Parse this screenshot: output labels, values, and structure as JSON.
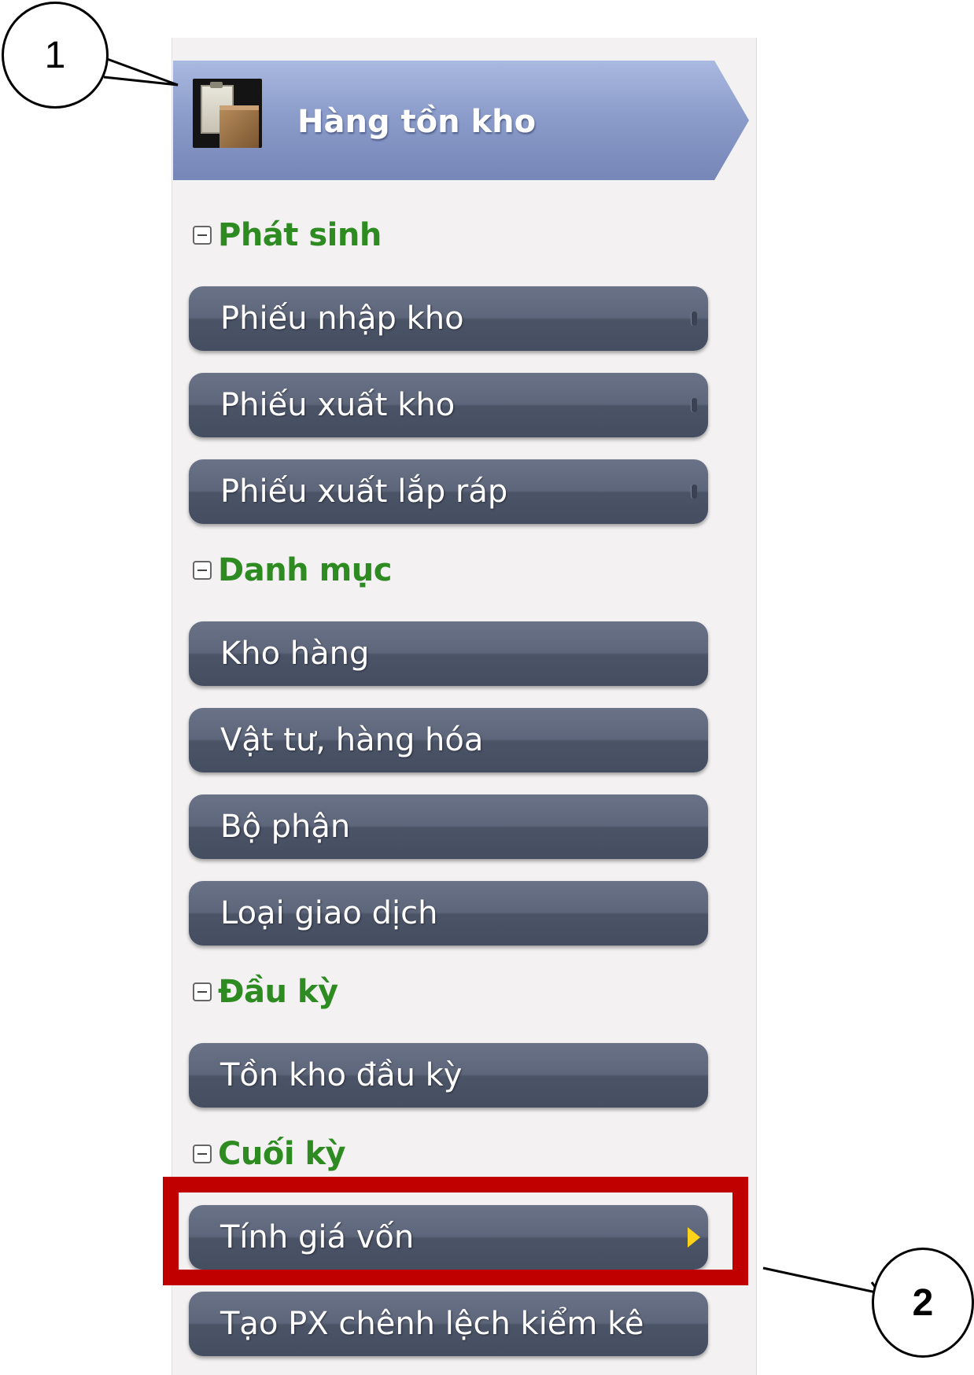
{
  "header": {
    "title": "Hàng tồn kho",
    "icon": "inventory-clipboard-box-icon"
  },
  "sections": [
    {
      "label": "Phát sinh",
      "items": [
        {
          "label": "Phiếu nhập kho"
        },
        {
          "label": "Phiếu xuất kho"
        },
        {
          "label": "Phiếu xuất lắp ráp"
        }
      ]
    },
    {
      "label": "Danh mục",
      "items": [
        {
          "label": "Kho hàng"
        },
        {
          "label": "Vật tư, hàng hóa"
        },
        {
          "label": "Bộ phận"
        },
        {
          "label": "Loại giao dịch"
        }
      ]
    },
    {
      "label": "Đầu kỳ",
      "items": [
        {
          "label": "Tồn kho đầu kỳ"
        }
      ]
    },
    {
      "label": "Cuối kỳ",
      "items": [
        {
          "label": "Tính giá vốn"
        },
        {
          "label": "Tạo PX chênh lệch kiểm kê"
        }
      ]
    }
  ],
  "callouts": {
    "one": "1",
    "two": "2"
  },
  "colors": {
    "section_label": "#2e8b22",
    "highlight": "#c00000",
    "submenu_arrow": "#ffd21a",
    "button": "#555d72"
  }
}
